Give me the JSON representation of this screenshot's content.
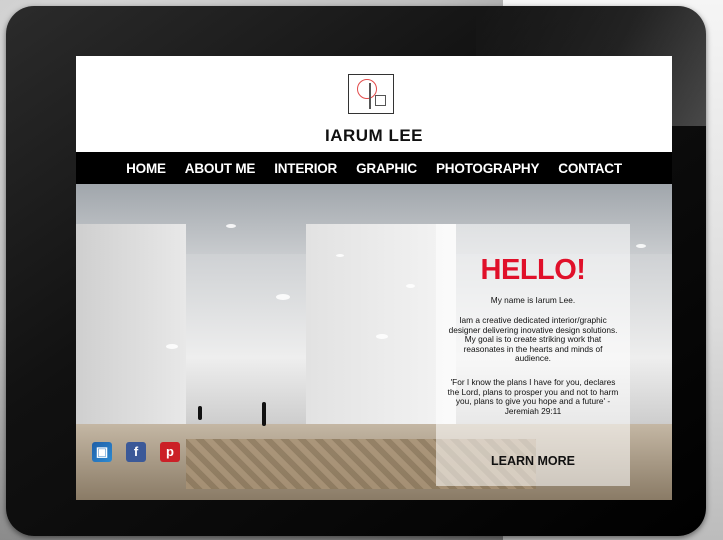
{
  "site": {
    "title": "IARUM LEE"
  },
  "nav": {
    "items": [
      "HOME",
      "ABOUT ME",
      "INTERIOR",
      "GRAPHIC",
      "PHOTOGRAPHY",
      "CONTACT"
    ]
  },
  "hero": {
    "greeting": "HELLO!",
    "intro": "My name is Iarum Lee.",
    "description": "Iam a creative dedicated interior/graphic designer delivering inovative design solutions. My goal is to create striking work that reasonates in the hearts and minds of audience.",
    "quote": "'For I know the plans I have for you, declares the Lord, plans to prosper you and not to harm you, plans to give you hope and a future' -Jeremiah 29:11",
    "cta": "LEARN MORE"
  },
  "social": {
    "instagram": "instagram-icon",
    "facebook": "facebook-icon",
    "pinterest": "pinterest-icon"
  },
  "colors": {
    "accent": "#e0102a",
    "nav_bg": "#000000"
  }
}
